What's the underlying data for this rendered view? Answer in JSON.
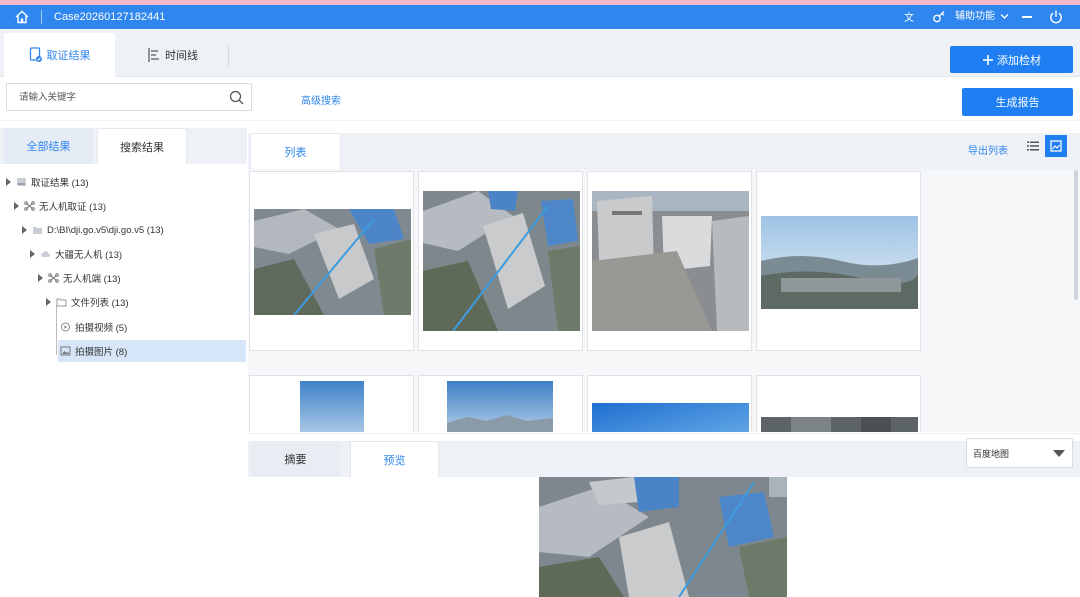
{
  "titlebar": {
    "case_name": "Case20260127182441",
    "assist_label": "辅助功能",
    "icons": [
      "home-icon",
      "translate-icon",
      "key-icon",
      "chevron-down-icon",
      "minimize-icon",
      "power-icon"
    ]
  },
  "main_tabs": [
    {
      "label": "取证结果",
      "icon": "document-icon",
      "active": true
    },
    {
      "label": "时间线",
      "icon": "timeline-icon",
      "active": false
    }
  ],
  "add_material_label": "添加检材",
  "search": {
    "placeholder": "请输入关键字",
    "value": ""
  },
  "advanced_search_label": "高级搜索",
  "generate_report_label": "生成报告",
  "left_tabs": [
    {
      "label": "全部结果",
      "active": true
    },
    {
      "label": "搜索结果",
      "active": false
    }
  ],
  "tree": [
    {
      "label": "取证结果 (13)",
      "level": 0,
      "icon": "db-icon",
      "selected": false
    },
    {
      "label": "无人机取证 (13)",
      "level": 1,
      "icon": "drone-icon",
      "selected": false
    },
    {
      "label": "D:\\BI\\dji.go.v5\\dji.go.v5 (13)",
      "level": 2,
      "icon": "folder-icon",
      "selected": false
    },
    {
      "label": "大疆无人机 (13)",
      "level": 3,
      "icon": "cloud-icon",
      "selected": false
    },
    {
      "label": "无人机端 (13)",
      "level": 4,
      "icon": "drone-icon",
      "selected": false
    },
    {
      "label": "文件列表 (13)",
      "level": 5,
      "icon": "folder-icon",
      "selected": false
    },
    {
      "label": "拍摄视频 (5)",
      "level": 6,
      "icon": "video-icon",
      "selected": false
    },
    {
      "label": "拍摄图片 (8)",
      "level": 6,
      "icon": "image-icon",
      "selected": true
    }
  ],
  "list_tab_label": "列表",
  "export_label": "导出列表",
  "view_modes": [
    {
      "icon": "list-view-icon",
      "active": false
    },
    {
      "icon": "grid-view-icon",
      "active": true
    }
  ],
  "bottom_tabs": [
    {
      "label": "摘要",
      "active": false
    },
    {
      "label": "预览",
      "active": true
    }
  ],
  "map_select": {
    "value": "百度地图"
  },
  "colors": {
    "accent": "#2f86ee",
    "titlebar": "#2f86ee",
    "button": "#1f7ff2",
    "selected_row": "#d6e6f8"
  }
}
